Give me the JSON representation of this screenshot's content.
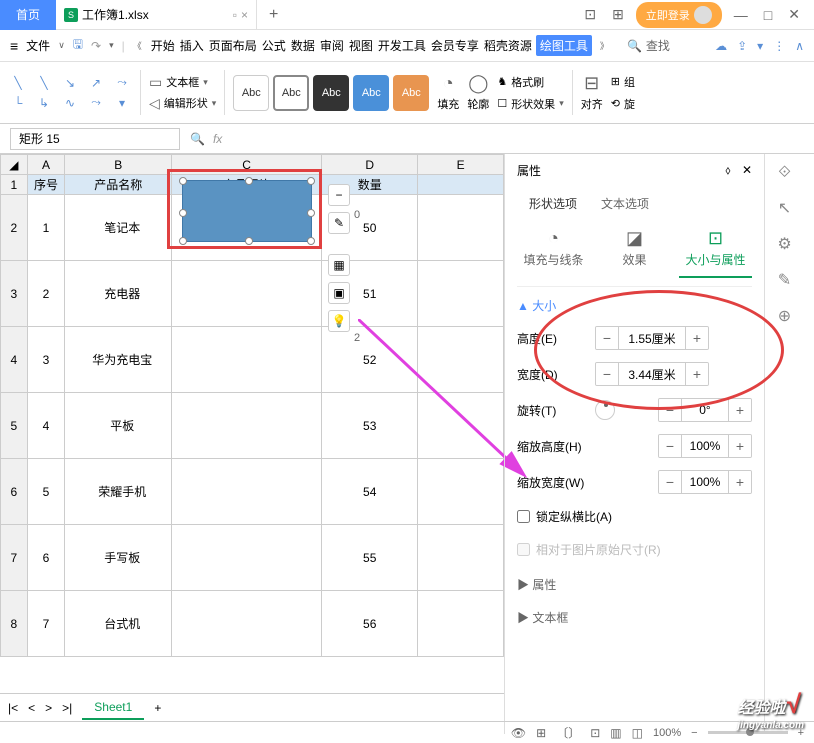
{
  "title": {
    "home": "首页",
    "docName": "工作簿1.xlsx",
    "login": "立即登录"
  },
  "menu": {
    "file": "文件",
    "items": [
      "开始",
      "插入",
      "页面布局",
      "公式",
      "数据",
      "审阅",
      "视图",
      "开发工具",
      "会员专享",
      "稻壳资源"
    ],
    "activeItem": "绘图工具",
    "search": "查找"
  },
  "toolbar": {
    "textbox": "文本框",
    "editShape": "编辑形状",
    "abc": "Abc",
    "fill": "填充",
    "outline": "轮廓",
    "format": "格式刷",
    "shapeEffect": "形状效果",
    "align": "对齐",
    "group": "组",
    "rotate": "旋"
  },
  "cellRef": "矩形 15",
  "headers": {
    "col": [
      "A",
      "B",
      "C",
      "D",
      "E"
    ],
    "dataHeaders": [
      "序号",
      "产品名称",
      "产品图片",
      "数量"
    ]
  },
  "rows": [
    {
      "n": "1",
      "name": "笔记本",
      "qty": "50"
    },
    {
      "n": "2",
      "name": "充电器",
      "qty": "51"
    },
    {
      "n": "3",
      "name": "华为充电宝",
      "qty": "52"
    },
    {
      "n": "4",
      "name": "平板",
      "qty": "53"
    },
    {
      "n": "5",
      "name": "荣耀手机",
      "qty": "54"
    },
    {
      "n": "6",
      "name": "手写板",
      "qty": "55"
    },
    {
      "n": "7",
      "name": "台式机",
      "qty": "56"
    }
  ],
  "floatLabels": [
    "0",
    "",
    "2"
  ],
  "panel": {
    "title": "属性",
    "tabs": [
      "形状选项",
      "文本选项"
    ],
    "subTabs": [
      "填充与线条",
      "效果",
      "大小与属性"
    ],
    "sections": {
      "size": "大小",
      "props": "属性",
      "textbox": "文本框"
    },
    "fields": {
      "height": {
        "label": "高度(E)",
        "value": "1.55厘米"
      },
      "width": {
        "label": "宽度(D)",
        "value": "3.44厘米"
      },
      "rotate": {
        "label": "旋转(T)",
        "value": "0°"
      },
      "scaleH": {
        "label": "缩放高度(H)",
        "value": "100%"
      },
      "scaleW": {
        "label": "缩放宽度(W)",
        "value": "100%"
      },
      "lock": "锁定纵横比(A)",
      "relative": "相对于图片原始尺寸(R)"
    }
  },
  "sheetTab": "Sheet1",
  "status": {
    "zoom": "100%"
  },
  "watermark": {
    "main": "经验啦",
    "sub": "jingyanla.com"
  }
}
